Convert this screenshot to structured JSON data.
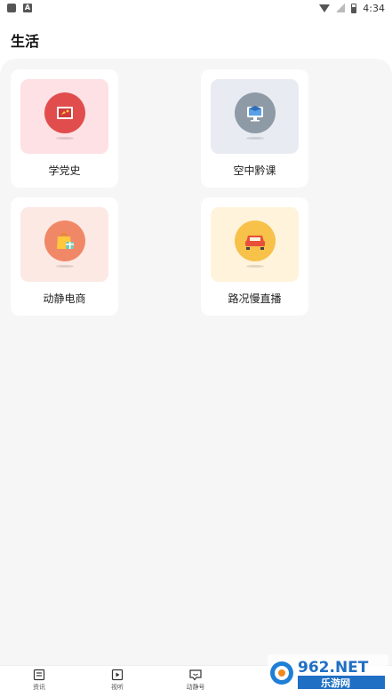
{
  "status_bar": {
    "time": "4:34"
  },
  "header": {
    "title": "生活"
  },
  "cards": [
    {
      "label": "学党史",
      "tile_color": "#fde1e4",
      "icon_color": "#e14d4d",
      "icon": "party-flag-icon"
    },
    {
      "label": "空中黔课",
      "tile_color": "#e8ecf2",
      "icon_color": "#8f9aa7",
      "icon": "monitor-graduation-icon"
    },
    {
      "label": "动静电商",
      "tile_color": "#fde9e4",
      "icon_color": "#f08868",
      "icon": "shopping-bag-icon"
    },
    {
      "label": "路况慢直播",
      "tile_color": "#fff3dc",
      "icon_color": "#f7c14a",
      "icon": "car-icon"
    }
  ],
  "bottom_nav": [
    {
      "label": "资讯",
      "icon": "news-icon"
    },
    {
      "label": "视听",
      "icon": "play-video-icon"
    },
    {
      "label": "动静号",
      "icon": "chat-bubble-icon"
    }
  ],
  "watermark": {
    "brand": "962.NET",
    "subtitle": "乐游网"
  }
}
